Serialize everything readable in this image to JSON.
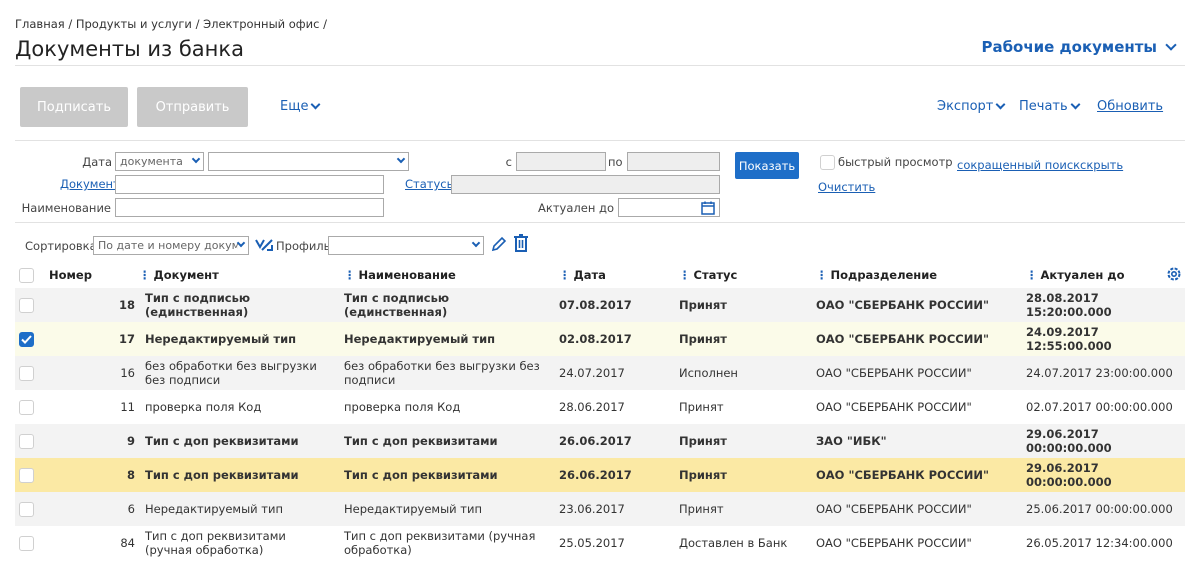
{
  "breadcrumb": "Главная / Продукты и услуги / Электронный офис /",
  "page_title": "Документы из банка",
  "work_docs": "Рабочие документы",
  "toolbar": {
    "sign": "Подписать",
    "send": "Отправить",
    "more": "Еще",
    "export": "Экспорт",
    "print": "Печать",
    "refresh": "Обновить"
  },
  "filters": {
    "date_label": "Дата",
    "date_type": "документа",
    "from_label": "с",
    "to_label": "по",
    "show": "Показать",
    "quick_view": "быстрый просмотр",
    "short_search": "сокращенный поиск",
    "hide": "скрыть",
    "document_label": "Документ",
    "statuses_label": "Статусы",
    "clear": "Очистить",
    "name_label": "Наименование",
    "actual_until_label": "Актуален до"
  },
  "sort": {
    "label": "Сортировка",
    "value": "По дате и номеру докуме",
    "profile_label": "Профиль"
  },
  "columns": [
    "Номер",
    "Документ",
    "Наименование",
    "Дата",
    "Статус",
    "Подразделение",
    "Актуален до"
  ],
  "rows": [
    {
      "num": "18",
      "doc": "Тип с подписью (единственная)",
      "name": "Тип с подписью (единственная)",
      "date": "07.08.2017",
      "status": "Принят",
      "dept": "ОАО \"СБЕРБАНК РОССИИ\"",
      "actual": "28.08.2017 15:20:00.000"
    },
    {
      "num": "17",
      "doc": "Нередактируемый тип",
      "name": "Нередактируемый тип",
      "date": "02.08.2017",
      "status": "Принят",
      "dept": "ОАО \"СБЕРБАНК РОССИИ\"",
      "actual": "24.09.2017 12:55:00.000"
    },
    {
      "num": "16",
      "doc": "без обработки без выгрузки без подписи",
      "name": "без обработки без выгрузки без подписи",
      "date": "24.07.2017",
      "status": "Исполнен",
      "dept": "ОАО \"СБЕРБАНК РОССИИ\"",
      "actual": "24.07.2017 23:00:00.000"
    },
    {
      "num": "11",
      "doc": "проверка поля Код",
      "name": "проверка поля Код",
      "date": "28.06.2017",
      "status": "Принят",
      "dept": "ОАО \"СБЕРБАНК РОССИИ\"",
      "actual": "02.07.2017 00:00:00.000"
    },
    {
      "num": "9",
      "doc": "Тип с доп реквизитами",
      "name": "Тип с доп реквизитами",
      "date": "26.06.2017",
      "status": "Принят",
      "dept": "ЗАО \"ИБК\"",
      "actual": "29.06.2017 00:00:00.000"
    },
    {
      "num": "8",
      "doc": "Тип с доп реквизитами",
      "name": "Тип с доп реквизитами",
      "date": "26.06.2017",
      "status": "Принят",
      "dept": "ОАО \"СБЕРБАНК РОССИИ\"",
      "actual": "29.06.2017 00:00:00.000"
    },
    {
      "num": "6",
      "doc": "Нередактируемый тип",
      "name": "Нередактируемый тип",
      "date": "23.06.2017",
      "status": "Принят",
      "dept": "ОАО \"СБЕРБАНК РОССИИ\"",
      "actual": "25.06.2017 00:00:00.000"
    },
    {
      "num": "84",
      "doc": "Тип с доп реквизитами (ручная обработка)",
      "name": "Тип с доп реквизитами (ручная обработка)",
      "date": "25.05.2017",
      "status": "Доставлен в Банк",
      "dept": "ОАО \"СБЕРБАНК РОССИИ\"",
      "actual": "26.05.2017 12:34:00.000"
    }
  ],
  "colors": {
    "accent": "#1e6ec8",
    "link": "#1a5fb4",
    "highlight": "#fbe9a4",
    "selected": "#fbfbe9"
  }
}
